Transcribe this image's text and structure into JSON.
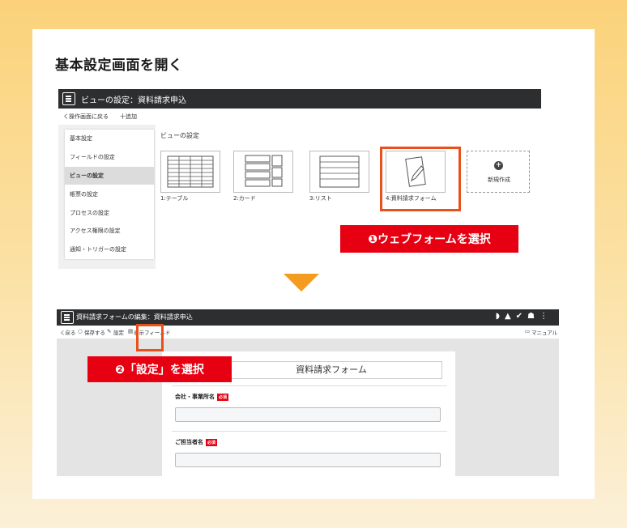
{
  "heading": "基本設定画面を開く",
  "screen1": {
    "app_title": "ビューの設定：資料請求申込",
    "back_link": "く操作画面に戻る",
    "add_link": "十追加",
    "sidebar_items": [
      "基本設定",
      "フィールドの設定",
      "ビューの設定",
      "帳票の設定",
      "プロセスの設定",
      "アクセス権限の設定",
      "通知・トリガーの設定"
    ],
    "main_title": "ビューの設定",
    "views": [
      {
        "label": "1:テーブル",
        "icon": "table-icon"
      },
      {
        "label": "2:カード",
        "icon": "card-icon"
      },
      {
        "label": "3:リスト",
        "icon": "list-icon"
      },
      {
        "label": "4:資料請求フォーム",
        "icon": "pencil-form-icon"
      }
    ],
    "new_view_label": "新規作成",
    "callout": "❶ウェブフォームを選択"
  },
  "screen2": {
    "app_title": "資料請求フォームの編集：資料請求申込",
    "back_link": "く戻る",
    "save_label": "保存する",
    "settings_label": "設定",
    "display_fields_label": "表示フィールド",
    "manual_label": "マニュアル",
    "form_title": "資料請求フォーム",
    "fields": [
      {
        "label": "会社・事業所名",
        "required": "必須"
      },
      {
        "label": "ご担当者名",
        "required": "必須"
      }
    ],
    "callout": "❷「設定」を選択"
  },
  "colors": {
    "accent": "#e8501c",
    "callout": "#e60012",
    "arrow": "#f39c1f",
    "topbar": "#2c2e30"
  }
}
